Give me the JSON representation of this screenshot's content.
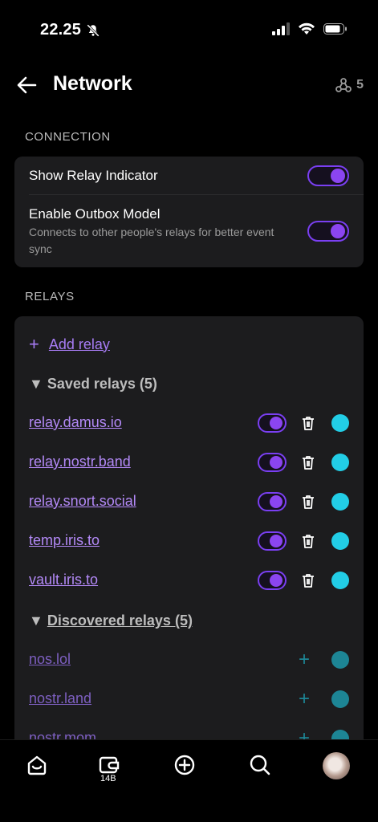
{
  "status_bar": {
    "time": "22.25"
  },
  "header": {
    "title": "Network",
    "relay_count": "5"
  },
  "connection": {
    "section_label": "CONNECTION",
    "show_relay_indicator": {
      "label": "Show Relay Indicator",
      "enabled": true
    },
    "outbox_model": {
      "label": "Enable Outbox Model",
      "description": "Connects to other people's relays for better event sync",
      "enabled": true
    }
  },
  "relays": {
    "section_label": "RELAYS",
    "add_relay_label": "Add relay",
    "saved_header": "Saved relays (5)",
    "saved": [
      {
        "url": "relay.damus.io",
        "enabled": true
      },
      {
        "url": "relay.nostr.band",
        "enabled": true
      },
      {
        "url": "relay.snort.social",
        "enabled": true
      },
      {
        "url": "temp.iris.to",
        "enabled": true
      },
      {
        "url": "vault.iris.to",
        "enabled": true
      }
    ],
    "discovered_header": "Discovered relays (5)",
    "discovered": [
      {
        "url": "nos.lol"
      },
      {
        "url": "nostr.land"
      },
      {
        "url": "nostr.mom"
      }
    ]
  },
  "bottom_nav": {
    "wallet_badge": "14B"
  },
  "colors": {
    "accent": "#8b45f0",
    "link": "#b389f7",
    "status_live": "#22cde6",
    "status_dim": "#1d8595",
    "card": "#1c1c1e"
  }
}
